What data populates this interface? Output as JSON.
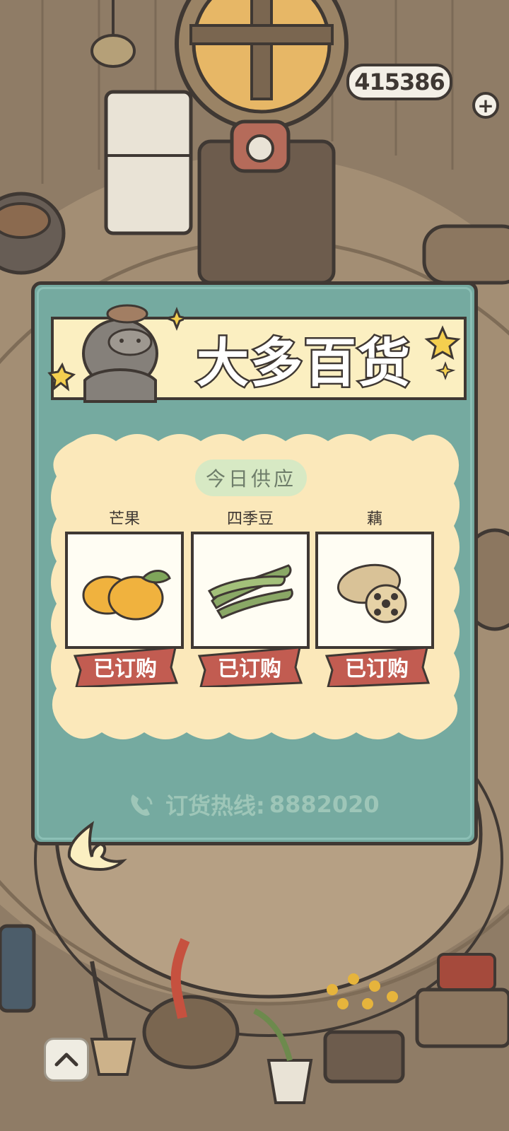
{
  "coins": "415386",
  "shop": {
    "title": "大多百货",
    "supply_label": "今日供应",
    "items": [
      {
        "name": "芒果",
        "status": "已订购",
        "icon": "mango-icon"
      },
      {
        "name": "四季豆",
        "status": "已订购",
        "icon": "green-bean-icon"
      },
      {
        "name": "藕",
        "status": "已订购",
        "icon": "lotus-root-icon"
      }
    ],
    "hotline_label": "订货热线:",
    "hotline_number": "8882020"
  },
  "colors": {
    "panel": "#75aaa0",
    "banner": "#fbefc1",
    "outline": "#3f3833",
    "ordered_button": "#c25c51",
    "background": "#8f7c66"
  }
}
